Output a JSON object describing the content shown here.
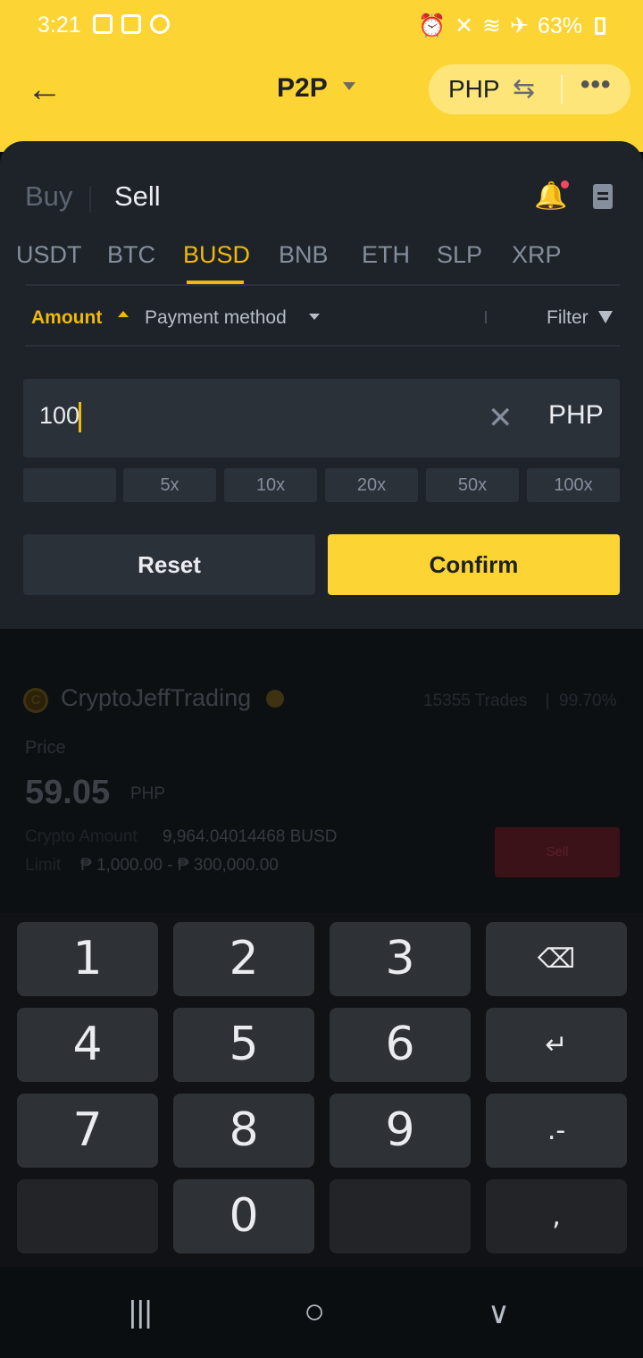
{
  "status_bar": {
    "time": "3:21",
    "battery": "63%"
  },
  "header": {
    "title": "P2P",
    "currency": "PHP",
    "back_icon": "arrow-left-icon",
    "swap_icon": "swap-icon",
    "more_icon": "more-icon"
  },
  "trade_side": {
    "buy": "Buy",
    "sell": "Sell"
  },
  "assets": [
    "USDT",
    "BTC",
    "BUSD",
    "BNB",
    "ETH",
    "SLP",
    "XRP"
  ],
  "filters": {
    "amount": "Amount",
    "payment": "Payment method",
    "filter": "Filter"
  },
  "amount_input": {
    "value": "100",
    "currency": "PHP"
  },
  "multipliers": [
    "",
    "5x",
    "10x",
    "20x",
    "50x",
    "100x"
  ],
  "actions": {
    "reset": "Reset",
    "confirm": "Confirm"
  },
  "listing": {
    "merchant": "CryptoJeffTrading",
    "coin_letter": "C",
    "trades": "15355 Trades",
    "completion": "99.70%",
    "price_label": "Price",
    "price": "59.05",
    "price_currency": "PHP",
    "crypto_label": "Crypto Amount",
    "crypto_value": "9,964.04014468 BUSD",
    "limit_label": "Limit",
    "limit_value": "₱ 1,000.00 - ₱ 300,000.00",
    "sell_button": "Sell"
  },
  "keyboard": {
    "rows": [
      [
        "1",
        "2",
        "3",
        "⌫"
      ],
      [
        "4",
        "5",
        "6",
        "↵"
      ],
      [
        "7",
        "8",
        "9",
        ".-"
      ],
      [
        "",
        "0",
        "",
        ","
      ]
    ]
  },
  "nav": {
    "recents": "|||",
    "home": "○",
    "back": "∨"
  },
  "colors": {
    "brand_yellow": "#fcd535",
    "accent": "#f0b90b",
    "panel": "#1e2329"
  }
}
